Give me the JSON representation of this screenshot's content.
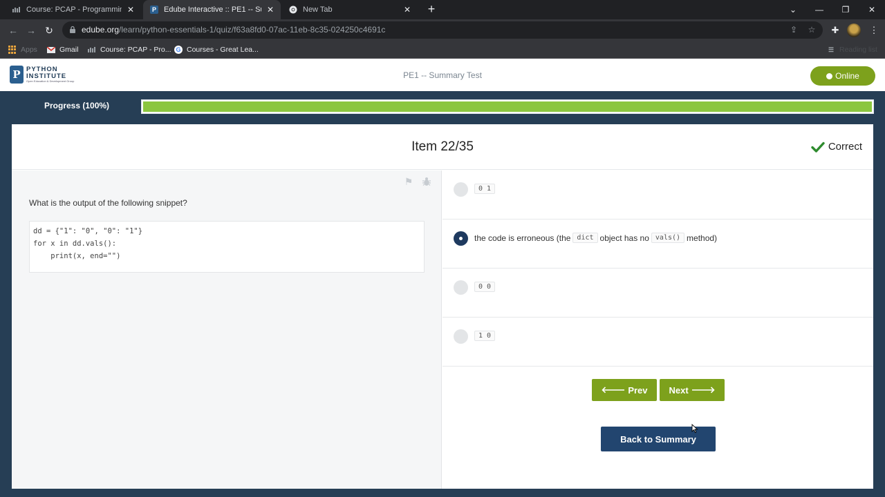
{
  "browser": {
    "tabs": [
      {
        "title": "Course: PCAP - Programming Ess",
        "active": false
      },
      {
        "title": "Edube Interactive :: PE1 -- Summ",
        "active": true
      },
      {
        "title": "New Tab",
        "active": false
      }
    ],
    "url_host": "edube.org",
    "url_path": "/learn/python-essentials-1/quiz/f63a8fd0-07ac-11eb-8c35-024250c4691c",
    "bookmarks": [
      {
        "label": "Apps",
        "icon": "apps-grid-icon"
      },
      {
        "label": "Gmail",
        "icon": "gmail-icon"
      },
      {
        "label": "Course: PCAP - Pro...",
        "icon": "edube-icon"
      },
      {
        "label": "Courses - Great Lea...",
        "icon": "google-icon"
      }
    ],
    "reading_list": "Reading list"
  },
  "site": {
    "logo_line1": "PYTHON",
    "logo_line2": "INSTITUTE",
    "logo_line3": "Open Education & Development Group",
    "test_title": "PE1 -- Summary Test",
    "online_label": "Online"
  },
  "progress": {
    "label": "Progress (100%)",
    "value": 1.0
  },
  "item": {
    "title": "Item 22/35",
    "result": "Correct",
    "question": "What is the output of the following snippet?",
    "code": "dd = {\"1\": \"0\", \"0\": \"1\"}\nfor x in dd.vals():\n    print(x, end=\"\")"
  },
  "answers": [
    {
      "selected": false,
      "parts": [
        {
          "code": "0 1"
        }
      ]
    },
    {
      "selected": true,
      "parts": [
        {
          "text": "the code is erroneous (the"
        },
        {
          "code": "dict"
        },
        {
          "text": "object has no"
        },
        {
          "code": "vals()"
        },
        {
          "text": "method)"
        }
      ]
    },
    {
      "selected": false,
      "parts": [
        {
          "code": "0 0"
        }
      ]
    },
    {
      "selected": false,
      "parts": [
        {
          "code": "1 0"
        }
      ]
    }
  ],
  "nav": {
    "prev": "Prev",
    "next": "Next",
    "back": "Back to Summary"
  },
  "colors": {
    "accent_green": "#7da11c",
    "progress_green": "#8bc63f",
    "navy": "#22456f",
    "page_bg": "#263e55"
  }
}
